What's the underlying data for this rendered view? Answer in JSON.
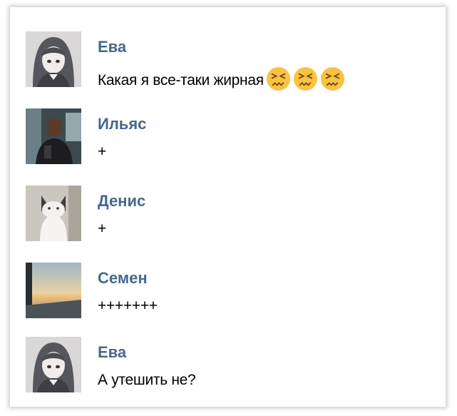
{
  "messages": [
    {
      "author": "Ева",
      "text": "Какая я все-таки жирная",
      "emojis": [
        "confounded-face-icon",
        "confounded-face-icon",
        "confounded-face-icon"
      ],
      "avatar": "anime-girl-avatar"
    },
    {
      "author": "Ильяс",
      "text": "+",
      "avatar": "man-photo-avatar"
    },
    {
      "author": "Денис",
      "text": "+",
      "avatar": "cat-photo-avatar"
    },
    {
      "author": "Семен",
      "text": "+++++++",
      "avatar": "sunset-photo-avatar"
    },
    {
      "author": "Ева",
      "text": "А утешить не?",
      "avatar": "anime-girl-avatar"
    }
  ],
  "colors": {
    "author_name": "#45688e",
    "message_text": "#000000",
    "emoji_face": "#f6c343"
  }
}
